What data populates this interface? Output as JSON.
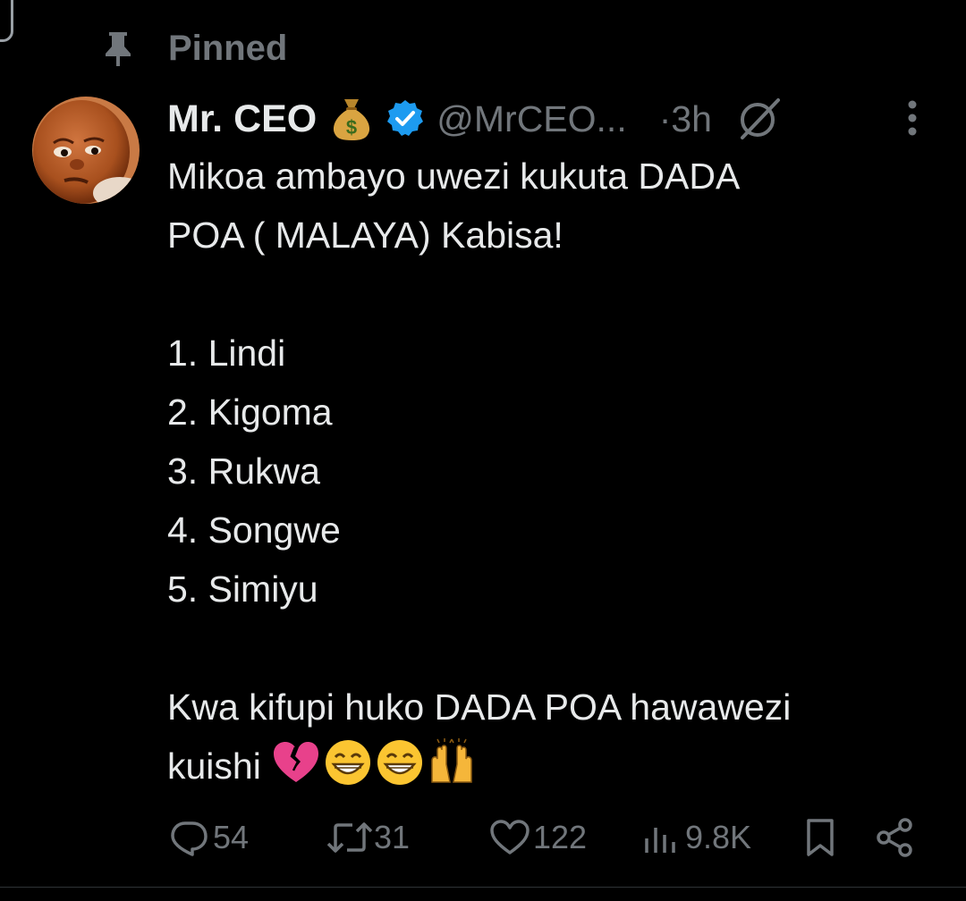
{
  "pinned": {
    "label": "Pinned"
  },
  "author": {
    "display_name": "Mr. CEO",
    "handle": "@MrCEO...",
    "time_separator": "·",
    "timestamp": "3h",
    "verified": true,
    "name_emoji": "money-bag-icon"
  },
  "tweet": {
    "line1": "Mikoa ambayo uwezi kukuta DADA",
    "line2": "POA ( MALAYA) Kabisa!",
    "list": [
      "1. Lindi",
      "2. Kigoma",
      "3. Rukwa",
      "4. Songwe",
      "5. Simiyu"
    ],
    "closing_line1": "Kwa kifupi huko DADA POA hawawezi",
    "closing_line2": "kuishi",
    "closing_emojis": [
      "broken-heart-icon",
      "grinning-face-icon",
      "grinning-face-icon",
      "raising-hands-icon"
    ]
  },
  "actions": {
    "replies": "54",
    "retweets": "31",
    "likes": "122",
    "views": "9.8K"
  },
  "colors": {
    "background": "#000000",
    "text": "#e7e9ea",
    "secondary": "#71767b",
    "verified": "#1d9bf0"
  }
}
